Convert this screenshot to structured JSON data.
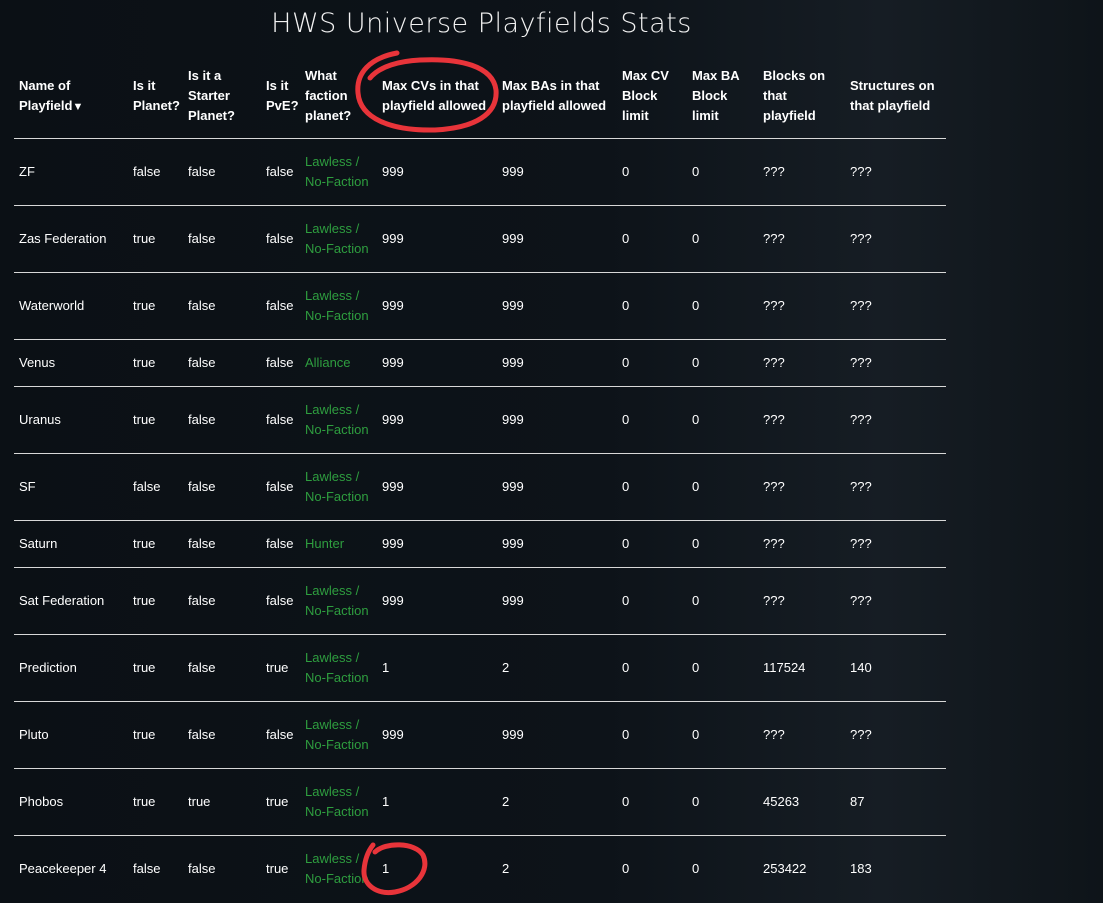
{
  "page": {
    "title": "HWS Universe Playfields Stats"
  },
  "table": {
    "headers": [
      "Name of Playfield",
      "Is it Planet?",
      "Is it a Starter Planet?",
      "Is it PvE?",
      "What faction planet?",
      "Max CVs in that playfield allowed",
      "Max BAs in that playfield allowed",
      "Max CV Block limit",
      "Max BA Block limit",
      "Blocks on that playfield",
      "Structures on that playfield"
    ],
    "sort_indicator": "▼",
    "rows": [
      {
        "name": "ZF",
        "planet": "false",
        "starter": "false",
        "pve": "false",
        "faction": "Lawless / No-Faction",
        "max_cv": "999",
        "max_ba": "999",
        "cv_limit": "0",
        "ba_limit": "0",
        "blocks": "???",
        "structures": "???"
      },
      {
        "name": "Zas Federation",
        "planet": "true",
        "starter": "false",
        "pve": "false",
        "faction": "Lawless / No-Faction",
        "max_cv": "999",
        "max_ba": "999",
        "cv_limit": "0",
        "ba_limit": "0",
        "blocks": "???",
        "structures": "???"
      },
      {
        "name": "Waterworld",
        "planet": "true",
        "starter": "false",
        "pve": "false",
        "faction": "Lawless / No-Faction",
        "max_cv": "999",
        "max_ba": "999",
        "cv_limit": "0",
        "ba_limit": "0",
        "blocks": "???",
        "structures": "???"
      },
      {
        "name": "Venus",
        "planet": "true",
        "starter": "false",
        "pve": "false",
        "faction": "Alliance",
        "max_cv": "999",
        "max_ba": "999",
        "cv_limit": "0",
        "ba_limit": "0",
        "blocks": "???",
        "structures": "???"
      },
      {
        "name": "Uranus",
        "planet": "true",
        "starter": "false",
        "pve": "false",
        "faction": "Lawless / No-Faction",
        "max_cv": "999",
        "max_ba": "999",
        "cv_limit": "0",
        "ba_limit": "0",
        "blocks": "???",
        "structures": "???"
      },
      {
        "name": "SF",
        "planet": "false",
        "starter": "false",
        "pve": "false",
        "faction": "Lawless / No-Faction",
        "max_cv": "999",
        "max_ba": "999",
        "cv_limit": "0",
        "ba_limit": "0",
        "blocks": "???",
        "structures": "???"
      },
      {
        "name": "Saturn",
        "planet": "true",
        "starter": "false",
        "pve": "false",
        "faction": "Hunter",
        "max_cv": "999",
        "max_ba": "999",
        "cv_limit": "0",
        "ba_limit": "0",
        "blocks": "???",
        "structures": "???"
      },
      {
        "name": "Sat Federation",
        "planet": "true",
        "starter": "false",
        "pve": "false",
        "faction": "Lawless / No-Faction",
        "max_cv": "999",
        "max_ba": "999",
        "cv_limit": "0",
        "ba_limit": "0",
        "blocks": "???",
        "structures": "???"
      },
      {
        "name": "Prediction",
        "planet": "true",
        "starter": "false",
        "pve": "true",
        "faction": "Lawless / No-Faction",
        "max_cv": "1",
        "max_ba": "2",
        "cv_limit": "0",
        "ba_limit": "0",
        "blocks": "117524",
        "structures": "140"
      },
      {
        "name": "Pluto",
        "planet": "true",
        "starter": "false",
        "pve": "false",
        "faction": "Lawless / No-Faction",
        "max_cv": "999",
        "max_ba": "999",
        "cv_limit": "0",
        "ba_limit": "0",
        "blocks": "???",
        "structures": "???"
      },
      {
        "name": "Phobos",
        "planet": "true",
        "starter": "true",
        "pve": "true",
        "faction": "Lawless / No-Faction",
        "max_cv": "1",
        "max_ba": "2",
        "cv_limit": "0",
        "ba_limit": "0",
        "blocks": "45263",
        "structures": "87"
      },
      {
        "name": "Peacekeeper 4",
        "planet": "false",
        "starter": "false",
        "pve": "true",
        "faction": "Lawless / No-Faction",
        "max_cv": "1",
        "max_ba": "2",
        "cv_limit": "0",
        "ba_limit": "0",
        "blocks": "253422",
        "structures": "183"
      }
    ]
  },
  "colors": {
    "faction_text": "#2e9e3f",
    "annotation": "#e8343a",
    "background": "#0c1116"
  }
}
